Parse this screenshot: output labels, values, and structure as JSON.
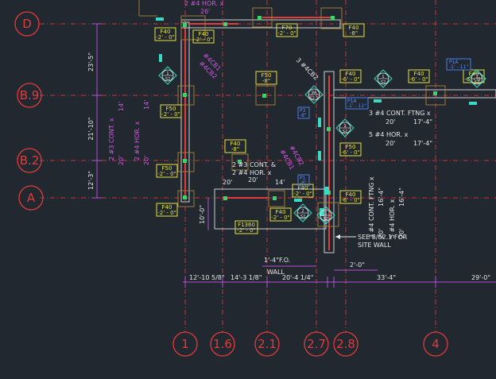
{
  "grid_rows": [
    {
      "id": "row-d",
      "label": "D"
    },
    {
      "id": "row-b9",
      "label": "B.9"
    },
    {
      "id": "row-b2",
      "label": "B.2"
    },
    {
      "id": "row-a",
      "label": "A"
    }
  ],
  "grid_cols": [
    {
      "id": "col-1",
      "label": "1"
    },
    {
      "id": "col-1-6",
      "label": "1.6"
    },
    {
      "id": "col-2-1",
      "label": "2.1"
    },
    {
      "id": "col-2-7",
      "label": "2.7"
    },
    {
      "id": "col-2-8",
      "label": "2.8"
    },
    {
      "id": "col-4",
      "label": "4"
    }
  ],
  "vertical_dims": [
    "23'-5\"",
    "21'-10\"",
    "12'-3\"",
    "10'-0\""
  ],
  "horizontal_dims": [
    "12'-10 5/8\"",
    "14'-3 1/8\"",
    "20'-4 1/4\"",
    "33'-4\"",
    "29'-0\"",
    "2'-0\"",
    "1'-4\"F.O.",
    "WALL"
  ],
  "footing_tags": [
    {
      "id": "f40-a",
      "type": "F40",
      "size": "-2' - 0\""
    },
    {
      "id": "f40-b",
      "type": "F40",
      "size": "-2' - 0\""
    },
    {
      "id": "f70",
      "type": "F70",
      "size": "-2' - 0\""
    },
    {
      "id": "f40-c",
      "type": "F40",
      "size": "-8\""
    },
    {
      "id": "f50-a",
      "type": "F50",
      "size": "-8\""
    },
    {
      "id": "f40-d",
      "type": "F40",
      "size": "-6' - 0\""
    },
    {
      "id": "f40-e",
      "type": "F40",
      "size": "-6' - 0\""
    },
    {
      "id": "f50-b",
      "type": "F50",
      "size": "-2' - 0\""
    },
    {
      "id": "f40-f",
      "type": "F40",
      "size": "-8\""
    },
    {
      "id": "f50-c",
      "type": "F50",
      "size": "-2' - 0\""
    },
    {
      "id": "f50-d",
      "type": "F50",
      "size": "-6' - 0\""
    },
    {
      "id": "f40-g",
      "type": "F40",
      "size": "-6' - 0\""
    },
    {
      "id": "f40-h",
      "type": "F40",
      "size": "-2' - 0\""
    },
    {
      "id": "f40-i",
      "type": "F40",
      "size": "-2' - 0\""
    },
    {
      "id": "f40-j",
      "type": "F40",
      "size": "-6' - 0\""
    },
    {
      "id": "f1360",
      "type": "F1360",
      "size": "-2' - 0\""
    },
    {
      "id": "f40-k",
      "type": "F40",
      "size": "-2' - 0\""
    }
  ],
  "rebar_notes": {
    "top": "2  #4  HOR.  x",
    "top_len": "26'",
    "left_a": "2  #3  CONT.  x",
    "left_a_len1": "20'",
    "left_a_len2": "14'",
    "left_b": "2  #4  HOR.  x",
    "left_b_len1": "20'",
    "left_b_len2": "14'",
    "mid_a": "2  #3  CONT.  &",
    "mid_b": "2  #4  HOR.  x",
    "mid_len1": "20'",
    "mid_len2": "20'",
    "mid_len3": "14'",
    "right_a": "3  #4  CONT.  FTNG  x",
    "right_a_len1": "20'",
    "right_a_len2": "17'-4\"",
    "right_b": "5  #4  HOR.  x",
    "right_b_len1": "20'",
    "right_b_len2": "17'-4\"",
    "right_v_a": "3  #4  CONT.  FTNG  x",
    "right_v_a_len1": "20'",
    "right_v_a_len2": "16'-4\"",
    "right_v_b": "5  #4  HOR.  x",
    "right_v_b_len1": "20'",
    "right_v_b_len2": "16'-4\"",
    "mag_a": "3  #4CB2",
    "mag_b": "#4CB1",
    "mag_c": "#4CB2",
    "mag_d": "#4CB1",
    "mag_e": "#4CB2"
  },
  "section_marks": [
    {
      "id": "sec-s2-a",
      "num": "1",
      "sheet": "S2"
    },
    {
      "id": "sec-s2-b",
      "num": "1",
      "sheet": "S2"
    },
    {
      "id": "sec-s2-c",
      "num": "2",
      "sheet": "S2"
    },
    {
      "id": "sec-9a",
      "num": "9A",
      "sheet": "S2.1"
    },
    {
      "id": "sec-s2-d",
      "num": "1",
      "sheet": "S2"
    },
    {
      "id": "sec-s2-e",
      "num": "2",
      "sheet": "S2"
    },
    {
      "id": "sec-s2-f",
      "num": "1",
      "sheet": "S2"
    }
  ],
  "pier_tags": [
    {
      "id": "p1a",
      "label": "P1A",
      "elev": "-1' - 11\""
    },
    {
      "id": "p1a-b",
      "label": "P1A",
      "elev": "-1' - 11\""
    },
    {
      "id": "p3",
      "label": "P3",
      "elev": "-8\""
    },
    {
      "id": "p1",
      "label": "P1",
      "elev": "-8\""
    }
  ],
  "callout": {
    "line1": "SEE 8/S2.1 FOR",
    "line2": "SITE WALL"
  }
}
